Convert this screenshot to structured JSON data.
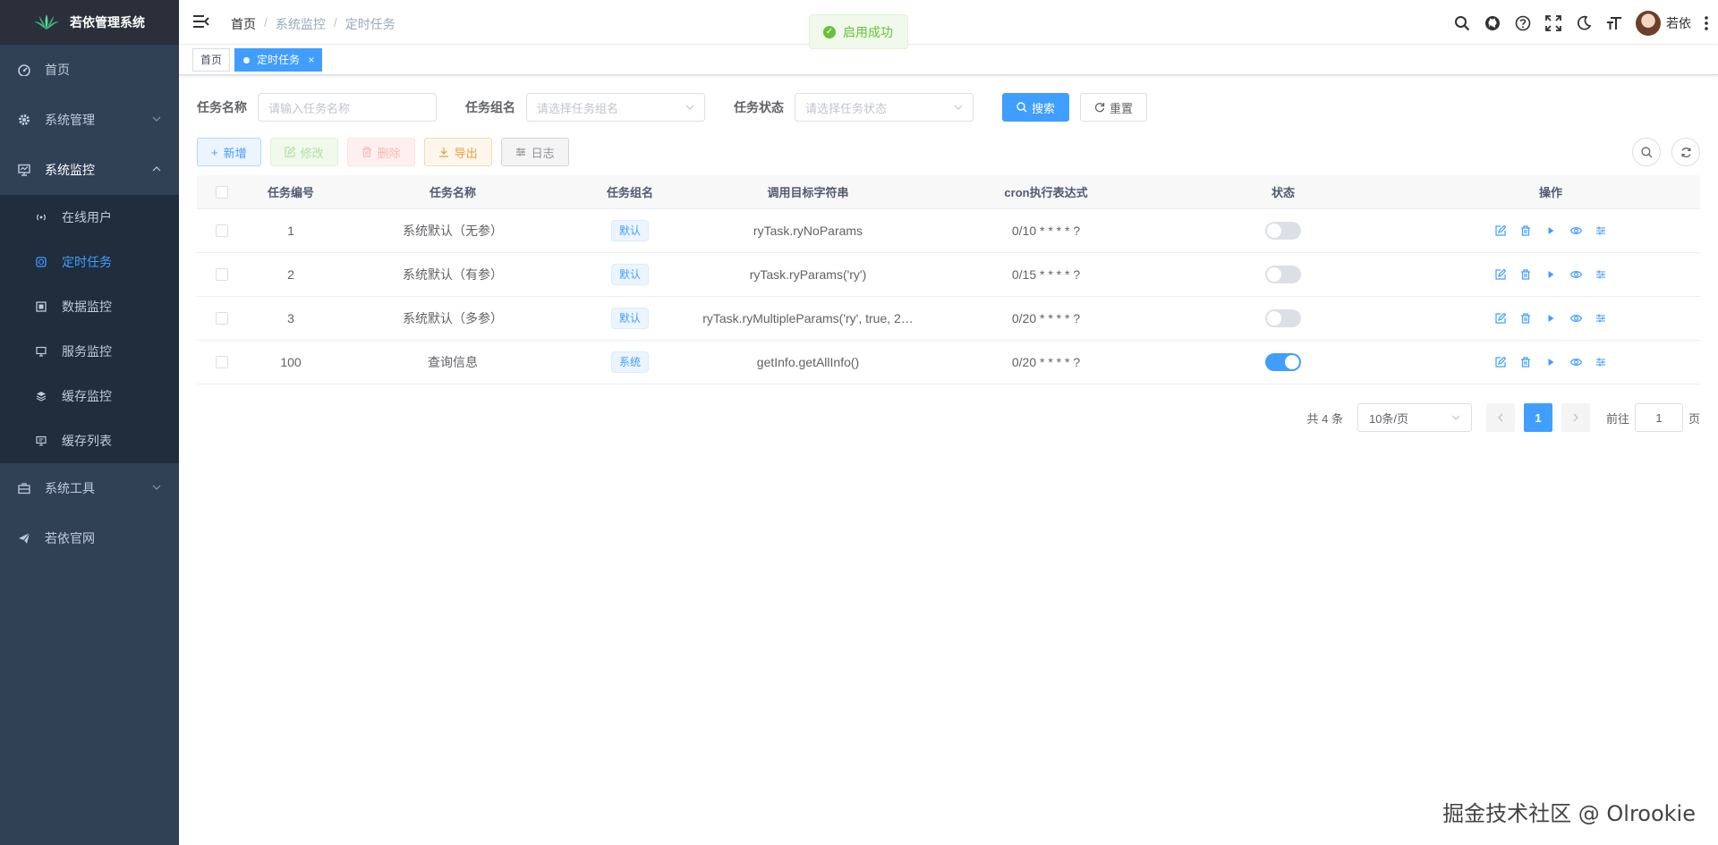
{
  "app": {
    "title": "若依管理系统"
  },
  "sidebar": {
    "items": [
      {
        "label": "首页",
        "icon": "dashboard-icon"
      },
      {
        "label": "系统管理",
        "icon": "gear-icon"
      },
      {
        "label": "系统监控",
        "icon": "monitor-icon"
      },
      {
        "label": "系统工具",
        "icon": "toolbox-icon"
      },
      {
        "label": "若依官网",
        "icon": "send-icon"
      }
    ],
    "monitor_sub": [
      {
        "label": "在线用户",
        "icon": "online-icon"
      },
      {
        "label": "定时任务",
        "icon": "job-icon"
      },
      {
        "label": "数据监控",
        "icon": "druid-icon"
      },
      {
        "label": "服务监控",
        "icon": "server-icon"
      },
      {
        "label": "缓存监控",
        "icon": "redis-icon"
      },
      {
        "label": "缓存列表",
        "icon": "redis-list-icon"
      }
    ]
  },
  "navbar": {
    "breadcrumb": [
      "首页",
      "系统监控",
      "定时任务"
    ],
    "separator": "/",
    "username": "若依"
  },
  "toast": {
    "text": "启用成功"
  },
  "tags": {
    "home": "首页",
    "current": "定时任务",
    "close": "×"
  },
  "search": {
    "name_label": "任务名称",
    "name_placeholder": "请输入任务名称",
    "group_label": "任务组名",
    "group_placeholder": "请选择任务组名",
    "status_label": "任务状态",
    "status_placeholder": "请选择任务状态",
    "search_button": "搜索",
    "reset_button": "重置"
  },
  "toolbar": {
    "add": "新增",
    "edit": "修改",
    "delete": "删除",
    "export": "导出",
    "log": "日志"
  },
  "table": {
    "headers": [
      "任务编号",
      "任务名称",
      "任务组名",
      "调用目标字符串",
      "cron执行表达式",
      "状态",
      "操作"
    ],
    "rows": [
      {
        "id": "1",
        "name": "系统默认（无参）",
        "group": "默认",
        "target": "ryTask.ryNoParams",
        "cron": "0/10 * * * * ?",
        "enabled": false
      },
      {
        "id": "2",
        "name": "系统默认（有参）",
        "group": "默认",
        "target": "ryTask.ryParams('ry')",
        "cron": "0/15 * * * * ?",
        "enabled": false
      },
      {
        "id": "3",
        "name": "系统默认（多参）",
        "group": "默认",
        "target": "ryTask.ryMultipleParams('ry', true, 2…",
        "cron": "0/20 * * * * ?",
        "enabled": false
      },
      {
        "id": "100",
        "name": "查询信息",
        "group": "系统",
        "target": "getInfo.getAllInfo()",
        "cron": "0/20 * * * * ?",
        "enabled": true
      }
    ]
  },
  "pagination": {
    "total": "共 4 条",
    "page_size": "10条/页",
    "current_page": "1",
    "goto_label": "前往",
    "goto_value": "1",
    "page_suffix": "页"
  },
  "watermark": "掘金技术社区 @ Olrookie",
  "colors": {
    "primary": "#409eff",
    "sidebar_bg": "#304156",
    "success": "#67c23a"
  }
}
